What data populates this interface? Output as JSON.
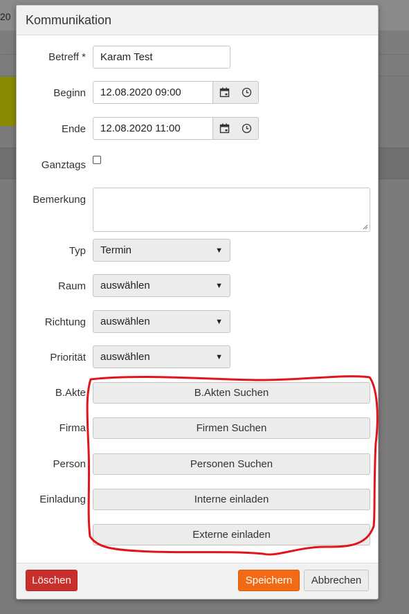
{
  "background": {
    "partial_number": "20"
  },
  "dialog": {
    "title": "Kommunikation",
    "betreff": {
      "label": "Betreff *",
      "value": "Karam Test"
    },
    "beginn": {
      "label": "Beginn",
      "value": "12.08.2020 09:00",
      "icons": [
        "calendar-icon",
        "clock-icon"
      ]
    },
    "ende": {
      "label": "Ende",
      "value": "12.08.2020 11:00",
      "icons": [
        "calendar-icon",
        "clock-icon"
      ]
    },
    "ganztags": {
      "label": "Ganztags",
      "checked": false
    },
    "bemerkung": {
      "label": "Bemerkung",
      "value": ""
    },
    "typ": {
      "label": "Typ",
      "selected": "Termin"
    },
    "raum": {
      "label": "Raum",
      "selected": "auswählen"
    },
    "richtung": {
      "label": "Richtung",
      "selected": "auswählen"
    },
    "prioritaet": {
      "label": "Priorität",
      "selected": "auswählen"
    },
    "bakte": {
      "label": "B.Akte",
      "button": "B.Akten Suchen"
    },
    "firma": {
      "label": "Firma",
      "button": "Firmen Suchen"
    },
    "person": {
      "label": "Person",
      "button": "Personen Suchen"
    },
    "einladung": {
      "label": "Einladung",
      "button_intern": "Interne einladen",
      "button_extern": "Externe einladen"
    },
    "footer": {
      "delete": "Löschen",
      "save": "Speichern",
      "cancel": "Abbrechen"
    }
  },
  "colors": {
    "delete_button": "#c9302c",
    "save_button": "#f26b14",
    "annotation_circle": "#e0161b"
  }
}
